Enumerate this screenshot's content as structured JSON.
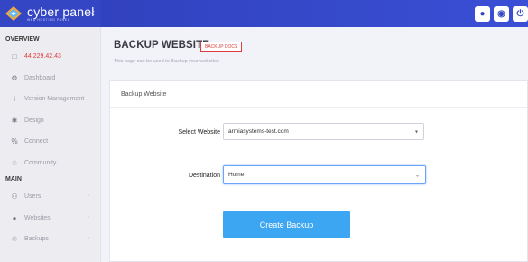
{
  "brand": {
    "name": "cyber panel",
    "tagline": "WEB HOSTING PANEL",
    "accent": "#3446c4"
  },
  "header": {
    "actions": [
      {
        "icon": "chat-icon",
        "glyph": "●"
      },
      {
        "icon": "headset-icon",
        "glyph": "◉"
      },
      {
        "icon": "power-icon",
        "glyph": "⏻"
      }
    ]
  },
  "sidebar": {
    "sections": [
      {
        "title": "OVERVIEW",
        "items": [
          {
            "label": "44.229.42.43",
            "icon": "monitor-icon",
            "glyph": "□"
          },
          {
            "label": "Dashboard",
            "icon": "dashboard-icon",
            "glyph": "⚙"
          },
          {
            "label": "Version Management",
            "icon": "info-icon",
            "glyph": "i"
          },
          {
            "label": "Design",
            "icon": "design-icon",
            "glyph": "✱"
          },
          {
            "label": "Connect",
            "icon": "connect-icon",
            "glyph": "%"
          },
          {
            "label": "Community",
            "icon": "community-icon",
            "glyph": "♧"
          }
        ]
      },
      {
        "title": "MAIN",
        "items": [
          {
            "label": "Users",
            "icon": "users-icon",
            "glyph": "⚇"
          },
          {
            "label": "Websites",
            "icon": "globe-icon",
            "glyph": "●"
          },
          {
            "label": "Backups",
            "icon": "backup-icon",
            "glyph": "♲"
          }
        ]
      }
    ]
  },
  "page": {
    "title": "BACKUP WEBSITE -",
    "docs_badge": "BACKUP DOCS",
    "subtitle": "This page can be used to Backup your websites",
    "card_title": "Backup Website"
  },
  "form": {
    "website_label": "Select Website",
    "website_value": "armiasystems-test.com",
    "destination_label": "Destination",
    "destination_value": "Home",
    "submit_label": "Create Backup"
  }
}
